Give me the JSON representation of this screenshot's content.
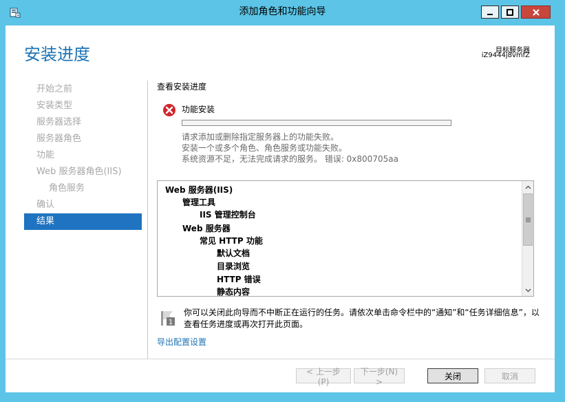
{
  "window": {
    "title": "添加角色和功能向导",
    "accent": "#5cc4e6",
    "close_color": "#c9463d"
  },
  "header": {
    "page_title": "安装进度",
    "server_label": "目标服务器",
    "server_name": "iZ9444j8vmfZ"
  },
  "nav": {
    "items": [
      {
        "label": "开始之前",
        "sub": false,
        "active": false
      },
      {
        "label": "安装类型",
        "sub": false,
        "active": false
      },
      {
        "label": "服务器选择",
        "sub": false,
        "active": false
      },
      {
        "label": "服务器角色",
        "sub": false,
        "active": false
      },
      {
        "label": "功能",
        "sub": false,
        "active": false
      },
      {
        "label": "Web 服务器角色(IIS)",
        "sub": false,
        "active": false
      },
      {
        "label": "角色服务",
        "sub": true,
        "active": false
      },
      {
        "label": "确认",
        "sub": false,
        "active": false
      },
      {
        "label": "结果",
        "sub": false,
        "active": true
      }
    ]
  },
  "main": {
    "section_title": "查看安装进度",
    "status_icon": "error-icon",
    "feature_label": "功能安装",
    "progress": 0,
    "messages": [
      "请求添加或删除指定服务器上的功能失败。",
      "安装一个或多个角色、角色服务或功能失败。",
      "系统资源不足，无法完成请求的服务。 错误: 0x800705aa"
    ],
    "tree": [
      {
        "label": "Web 服务器(IIS)",
        "level": 0
      },
      {
        "label": "管理工具",
        "level": 1
      },
      {
        "label": "IIS 管理控制台",
        "level": 2
      },
      {
        "label": "Web 服务器",
        "level": 1
      },
      {
        "label": "常见 HTTP 功能",
        "level": 2
      },
      {
        "label": "默认文档",
        "level": 3
      },
      {
        "label": "目录浏览",
        "level": 3
      },
      {
        "label": "HTTP 错误",
        "level": 3
      },
      {
        "label": "静态内容",
        "level": 3
      }
    ],
    "note_badge": "1",
    "note_text": "你可以关闭此向导而不中断正在运行的任务。请依次单击命令栏中的“通知”和“任务详细信息”，以查看任务进度或再次打开此页面。",
    "export_link": "导出配置设置"
  },
  "footer": {
    "prev_label": "< 上一步(P)",
    "next_label": "下一步(N) >",
    "close_label": "关闭",
    "cancel_label": "取消"
  }
}
